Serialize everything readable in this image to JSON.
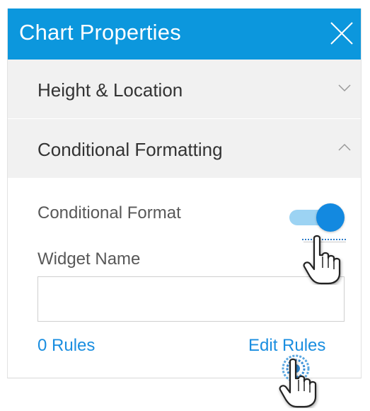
{
  "panel": {
    "title": "Chart Properties",
    "close_icon": "close-icon"
  },
  "sections": {
    "height_location": {
      "label": "Height & Location",
      "expanded": false,
      "icon": "chevron-down-icon"
    },
    "conditional_formatting": {
      "label": "Conditional Formatting",
      "expanded": true,
      "icon": "chevron-up-icon"
    }
  },
  "conditional": {
    "toggle_label": "Conditional Format",
    "toggle_on": true,
    "widget_name_label": "Widget Name",
    "widget_name_value": "",
    "widget_name_placeholder": "",
    "rules_count_label": "0 Rules",
    "edit_rules_label": "Edit Rules"
  },
  "colors": {
    "header_bg": "#0c97dd",
    "accent": "#1a8ee0",
    "toggle_track": "#9cd3f3",
    "toggle_knob": "#1389e0",
    "section_bg": "#f1f1f1"
  },
  "cursors": [
    "hand-pointer-cursor",
    "hand-pointer-click-cursor"
  ]
}
